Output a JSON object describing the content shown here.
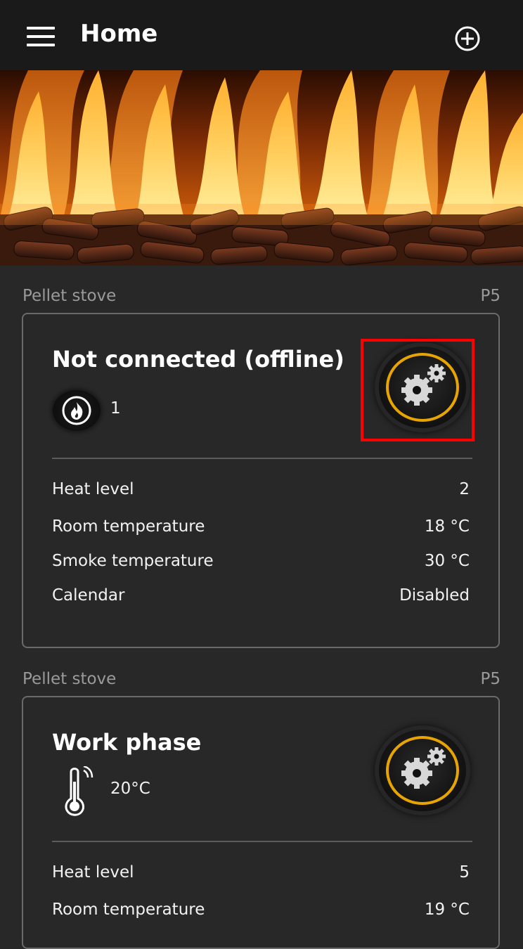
{
  "header": {
    "title": "Home"
  },
  "devices": [
    {
      "type_label": "Pellet stove",
      "model": "P5",
      "status": "Not connected (offline)",
      "indicator_value": "1",
      "indicator_icon": "flame-icon",
      "rows": [
        {
          "label": "Heat level",
          "value": "2"
        },
        {
          "label": "Room temperature",
          "value": "18 °C"
        },
        {
          "label": "Smoke temperature",
          "value": "30 °C"
        },
        {
          "label": "Calendar",
          "value": "Disabled"
        }
      ]
    },
    {
      "type_label": "Pellet stove",
      "model": "P5",
      "status": "Work phase",
      "indicator_value": "20°C",
      "indicator_icon": "thermometer-icon",
      "rows": [
        {
          "label": "Heat level",
          "value": "5"
        },
        {
          "label": "Room temperature",
          "value": "19 °C"
        }
      ]
    }
  ],
  "colors": {
    "accent_ring": "#e8a400",
    "highlight": "#ff0000",
    "background": "#282828",
    "appbar": "#1a1a1a"
  }
}
